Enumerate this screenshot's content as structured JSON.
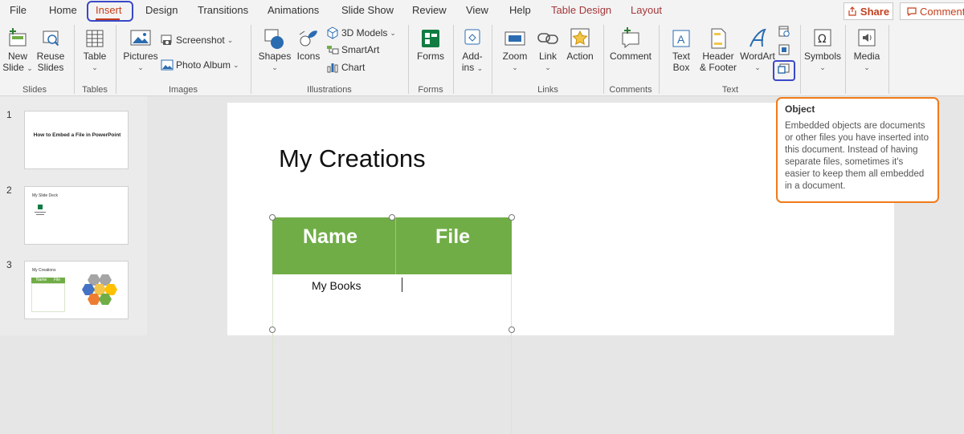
{
  "tabs": [
    "File",
    "Home",
    "Insert",
    "Design",
    "Transitions",
    "Animations",
    "Slide Show",
    "Review",
    "View",
    "Help",
    "Table Design",
    "Layout"
  ],
  "share_label": "Share",
  "comments_label": "Comments",
  "ribbon": {
    "new_slide": [
      "New",
      "Slide"
    ],
    "reuse_slides": [
      "Reuse",
      "Slides"
    ],
    "table": "Table",
    "pictures": "Pictures",
    "screenshot": "Screenshot",
    "photo_album": "Photo Album",
    "shapes": "Shapes",
    "icons": "Icons",
    "models_3d": "3D Models",
    "smartart": "SmartArt",
    "chart": "Chart",
    "forms": "Forms",
    "addins": [
      "Add-",
      "ins"
    ],
    "zoom": "Zoom",
    "link": "Link",
    "action": "Action",
    "comment": "Comment",
    "text_box": [
      "Text",
      "Box"
    ],
    "header_footer": [
      "Header",
      "& Footer"
    ],
    "wordart": "WordArt",
    "symbols": "Symbols",
    "media": "Media",
    "groups": {
      "slides": "Slides",
      "tables": "Tables",
      "images": "Images",
      "illustrations": "Illustrations",
      "forms": "Forms",
      "links": "Links",
      "comments": "Comments",
      "text": "Text"
    }
  },
  "thumbnails": {
    "numbers": [
      "1",
      "2",
      "3"
    ],
    "slide1_title": "How to Embed a File in PowerPoint",
    "slide2_title": "My Slide Deck",
    "slide3_title": "My Creations",
    "slide3_headers": [
      "Name",
      "File"
    ]
  },
  "slide": {
    "title": "My Creations",
    "table_headers": [
      "Name",
      "File"
    ],
    "table_cell": "My Books"
  },
  "tooltip": {
    "title": "Object",
    "body": "Embedded objects are documents or other files you have inserted into this document. Instead of having separate files, sometimes it's easier to keep them all embedded in a document."
  },
  "colors": {
    "accent": "#c43e1c",
    "table_green": "#70ad47",
    "tooltip_border": "#f07a1a",
    "highlight": "#3a48c8"
  }
}
